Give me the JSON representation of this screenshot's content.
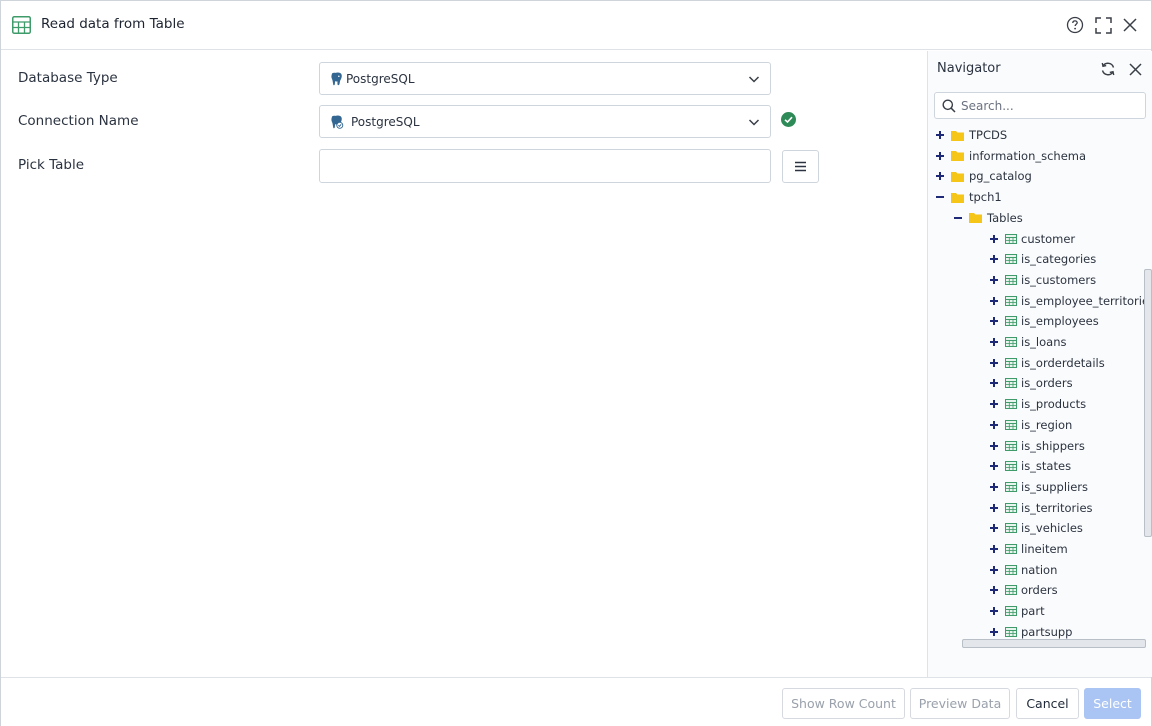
{
  "dialog": {
    "title": "Read data from Table"
  },
  "form": {
    "database_type": {
      "label": "Database Type",
      "value": "PostgreSQL"
    },
    "connection_name": {
      "label": "Connection Name",
      "value": "PostgreSQL",
      "status": "connected"
    },
    "pick_table": {
      "label": "Pick Table",
      "value": ""
    }
  },
  "navigator": {
    "title": "Navigator",
    "search_placeholder": "Search...",
    "tree": [
      {
        "label": "TPCDS",
        "type": "folder",
        "expanded": false,
        "level": 0
      },
      {
        "label": "information_schema",
        "type": "folder",
        "expanded": false,
        "level": 0
      },
      {
        "label": "pg_catalog",
        "type": "folder",
        "expanded": false,
        "level": 0
      },
      {
        "label": "tpch1",
        "type": "folder",
        "expanded": true,
        "level": 0
      },
      {
        "label": "Tables",
        "type": "folder",
        "expanded": true,
        "level": 1
      },
      {
        "label": "customer",
        "type": "table",
        "level": 2
      },
      {
        "label": "is_categories",
        "type": "table",
        "level": 2
      },
      {
        "label": "is_customers",
        "type": "table",
        "level": 2
      },
      {
        "label": "is_employee_territories",
        "type": "table",
        "level": 2
      },
      {
        "label": "is_employees",
        "type": "table",
        "level": 2
      },
      {
        "label": "is_loans",
        "type": "table",
        "level": 2
      },
      {
        "label": "is_orderdetails",
        "type": "table",
        "level": 2
      },
      {
        "label": "is_orders",
        "type": "table",
        "level": 2
      },
      {
        "label": "is_products",
        "type": "table",
        "level": 2
      },
      {
        "label": "is_region",
        "type": "table",
        "level": 2
      },
      {
        "label": "is_shippers",
        "type": "table",
        "level": 2
      },
      {
        "label": "is_states",
        "type": "table",
        "level": 2
      },
      {
        "label": "is_suppliers",
        "type": "table",
        "level": 2
      },
      {
        "label": "is_territories",
        "type": "table",
        "level": 2
      },
      {
        "label": "is_vehicles",
        "type": "table",
        "level": 2
      },
      {
        "label": "lineitem",
        "type": "table",
        "level": 2
      },
      {
        "label": "nation",
        "type": "table",
        "level": 2
      },
      {
        "label": "orders",
        "type": "table",
        "level": 2
      },
      {
        "label": "part",
        "type": "table",
        "level": 2
      },
      {
        "label": "partsupp",
        "type": "table",
        "level": 2
      }
    ]
  },
  "footer": {
    "show_row_count": "Show Row Count",
    "preview_data": "Preview Data",
    "cancel": "Cancel",
    "select": "Select"
  },
  "icons": {
    "title": "table-grid-icon",
    "help": "help-circle-icon",
    "maximize": "maximize-icon",
    "close": "close-icon",
    "db": "postgresql-elephant-icon",
    "status": "check-circle-icon",
    "menu": "hamburger-menu-icon",
    "refresh": "refresh-icon",
    "search": "search-icon",
    "folder": "folder-icon",
    "table": "table-icon"
  },
  "colors": {
    "accent_green": "#3f9b6a",
    "folder_yellow": "#f5c518",
    "primary_button": "#aac4f3",
    "tree_toggle": "#1e2a78"
  }
}
